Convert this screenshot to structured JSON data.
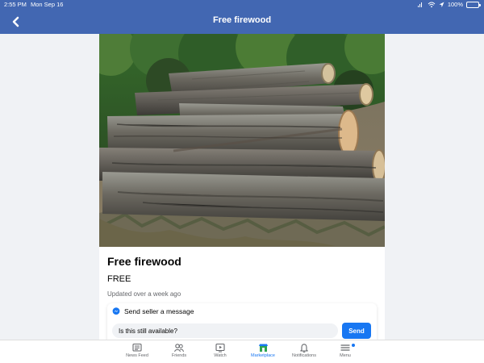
{
  "status_bar": {
    "time": "2:55 PM",
    "date": "Mon Sep 16",
    "battery": "100%",
    "battery_level": 1.0
  },
  "header": {
    "title": "Free firewood",
    "back_icon": "chevron-left-icon"
  },
  "listing": {
    "image_description": "stack of cut logs",
    "title": "Free firewood",
    "price": "FREE",
    "updated": "Updated over a week ago"
  },
  "message": {
    "header_icon": "messenger-icon",
    "header": "Send seller a message",
    "input_value": "Is this still available?",
    "send_label": "Send"
  },
  "bottom_nav": {
    "items": [
      {
        "label": "News Feed",
        "icon": "news-feed-icon"
      },
      {
        "label": "Friends",
        "icon": "friends-icon"
      },
      {
        "label": "Watch",
        "icon": "watch-icon"
      },
      {
        "label": "Marketplace",
        "icon": "marketplace-icon"
      },
      {
        "label": "Notifications",
        "icon": "bell-icon"
      },
      {
        "label": "Menu",
        "icon": "menu-icon"
      }
    ],
    "active": "Marketplace"
  },
  "colors": {
    "header": "#4267b2",
    "accent": "#1877f2",
    "muted": "#65676b",
    "battery": "#4cd964"
  }
}
